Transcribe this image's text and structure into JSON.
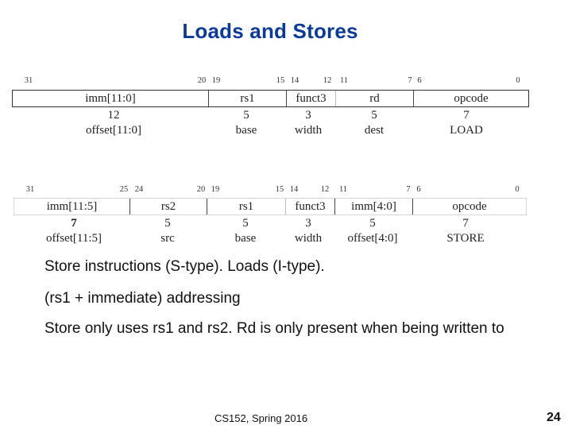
{
  "slide": {
    "title": "Loads and Stores",
    "footer": "CS152, Spring 2016",
    "page_number": "24"
  },
  "load_format": {
    "bit_labels": [
      "31",
      "20",
      "19",
      "15",
      "14",
      "12",
      "11",
      "7",
      "6",
      "0"
    ],
    "fields": [
      {
        "name": "imm[11:0]",
        "width": "12",
        "meaning": "offset[11:0]"
      },
      {
        "name": "rs1",
        "width": "5",
        "meaning": "base"
      },
      {
        "name": "funct3",
        "width": "3",
        "meaning": "width"
      },
      {
        "name": "rd",
        "width": "5",
        "meaning": "dest"
      },
      {
        "name": "opcode",
        "width": "7",
        "meaning": "LOAD"
      }
    ]
  },
  "store_format": {
    "bit_labels": [
      "31",
      "25",
      "24",
      "20",
      "19",
      "15",
      "14",
      "12",
      "11",
      "7",
      "6",
      "0"
    ],
    "fields": [
      {
        "name": "imm[11:5]",
        "width": "7",
        "meaning": "offset[11:5]"
      },
      {
        "name": "rs2",
        "width": "5",
        "meaning": "src"
      },
      {
        "name": "rs1",
        "width": "5",
        "meaning": "base"
      },
      {
        "name": "funct3",
        "width": "3",
        "meaning": "width"
      },
      {
        "name": "imm[4:0]",
        "width": "5",
        "meaning": "offset[4:0]"
      },
      {
        "name": "opcode",
        "width": "7",
        "meaning": "STORE"
      }
    ]
  },
  "bullets": [
    "Store instructions (S-type). Loads (I-type).",
    "(rs1 + immediate) addressing",
    "Store only uses rs1 and rs2. Rd is only present when being written to"
  ]
}
